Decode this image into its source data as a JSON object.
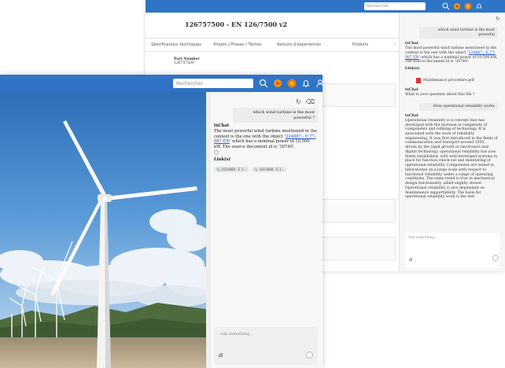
{
  "back_window": {
    "search_placeholder": "Rechercher",
    "title": "126757500 - EN 126/7500 v2",
    "tabs": [
      "Spécifications techniques",
      "Projets / Phases / Tâches",
      "Retours d'expériences",
      "Produits"
    ],
    "tabs_more": "›",
    "part_label": "Part Number",
    "part_value": "126757500",
    "chat": {
      "user_q1": "which wind turbine is the most powerful",
      "bot_name": "txChat",
      "answer_pre": "The most powerful wind turbine mentioned in the context is the one with the object '",
      "answer_link": "224887 - E 77-987 EN",
      "answer_post": "' which has a nominal power of 10,500 kW. The source document id is '30740'.",
      "links_label": "Link(s)",
      "file": "Maintenance procedure.pdf",
      "bot_name2": "txChat",
      "question_prompt": "What is your question about this file ?",
      "user_q2": "How operational reliability works",
      "bot_name3": "txChat",
      "long_answer": "Operational reliability is a concept that has developed with the increase in complexity of components and refining of technology. It is associated with the work of reliability engineering. It was first introduced in the fields of communication and transport around 1950, driven by the rapid growth in electronics and digital technology, operational reliability has now firmly established, with well-developed systems in place for function check-out and monitoring of operational reliability. Components are tested in laboratories on a large scale with respect to functional reliability under a range of operating conditions. The same trend is true in mechanical design functionality, albeit slightly slower. Operational reliability is also dependent on maintenance supportability. The basis for operational reliability work is the test",
      "input_placeholder": "Ask something..."
    }
  },
  "front_window": {
    "search_placeholder": "Rechercher",
    "chat": {
      "user_question": "which wind turbine is the most powerful ?",
      "bot_name": "txChat",
      "answer_pre": "The most powerful wind turbine mentioned in the context is the one with the object '",
      "answer_link": "224887 - E 77-987 EN",
      "answer_post": "' which has a nominal power of 10,500 kW. The source document id is '30740'.",
      "answer_marker": "◯",
      "links_label": "Link(s)",
      "chips": [
        "📎 1610888 - E 1...",
        "📎 1610888 - E 1..."
      ],
      "input_placeholder": "Ask something..."
    }
  },
  "colors": {
    "topbar": "#2f74c6",
    "link": "#2255cc",
    "sky_top": "#2c6fb8",
    "sky_bottom": "#c8def0"
  },
  "icons": [
    "search-icon",
    "logo-icon",
    "grid-icon",
    "bell-icon",
    "user-icon",
    "refresh-icon",
    "eraser-icon",
    "paperclip-icon",
    "send-icon",
    "pdf-icon"
  ]
}
